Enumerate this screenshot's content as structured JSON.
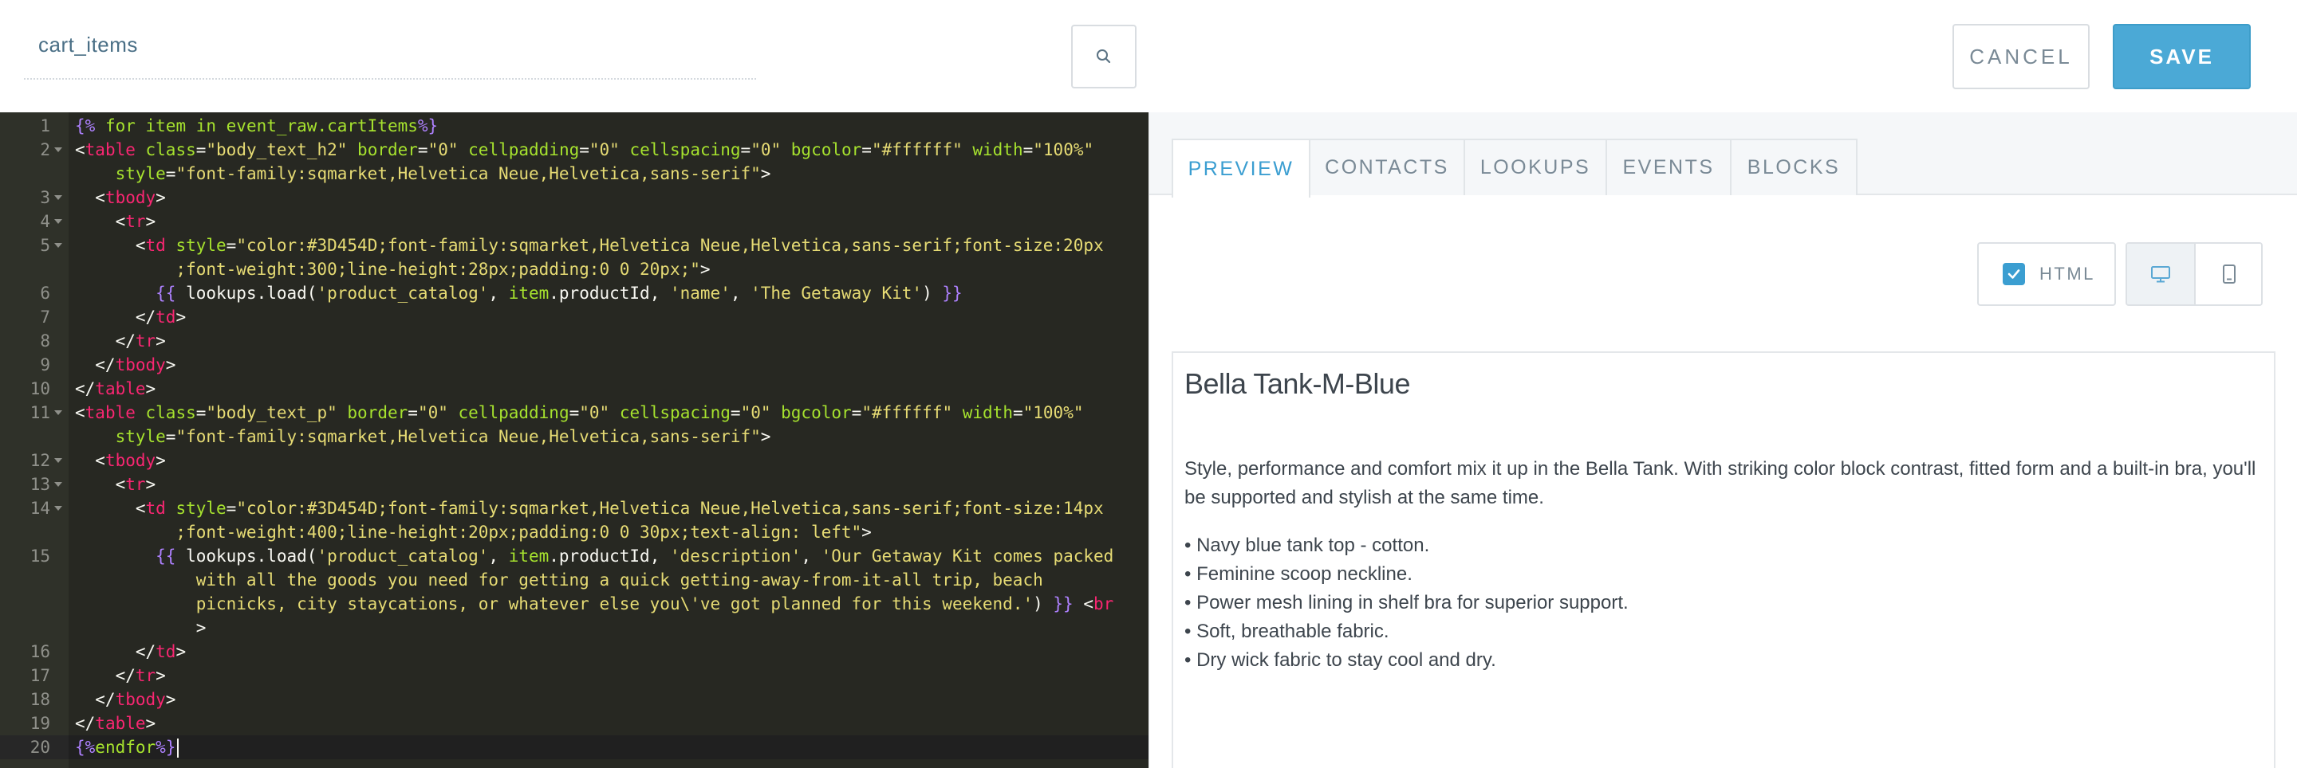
{
  "header": {
    "name_value": "cart_items",
    "cancel_label": "CANCEL",
    "save_label": "SAVE"
  },
  "editor": {
    "lines": [
      {
        "n": "1",
        "fold": false,
        "rows": [
          [
            [
              "dl",
              "{%"
            ],
            [
              "tp",
              " for item in event_raw.cartItems"
            ],
            [
              "dl",
              "%}"
            ]
          ]
        ]
      },
      {
        "n": "2",
        "fold": true,
        "rows": [
          [
            [
              "pt",
              "<"
            ],
            [
              "tg",
              "table"
            ],
            [
              "at",
              " class"
            ],
            [
              "pt",
              "="
            ],
            [
              "st",
              "\"body_text_h2\""
            ],
            [
              "at",
              " border"
            ],
            [
              "pt",
              "="
            ],
            [
              "st",
              "\"0\""
            ],
            [
              "at",
              " cellpadding"
            ],
            [
              "pt",
              "="
            ],
            [
              "st",
              "\"0\""
            ],
            [
              "at",
              " cellspacing"
            ],
            [
              "pt",
              "="
            ],
            [
              "st",
              "\"0\""
            ],
            [
              "at",
              " bgcolor"
            ],
            [
              "pt",
              "="
            ],
            [
              "st",
              "\"#ffffff\""
            ],
            [
              "at",
              " width"
            ],
            [
              "pt",
              "="
            ],
            [
              "st",
              "\"100%\""
            ]
          ],
          [
            [
              "at",
              "    style"
            ],
            [
              "pt",
              "="
            ],
            [
              "st",
              "\"font-family:sqmarket,Helvetica Neue,Helvetica,sans-serif\""
            ],
            [
              "pt",
              ">"
            ]
          ]
        ]
      },
      {
        "n": "3",
        "fold": true,
        "rows": [
          [
            [
              "pt",
              "  <"
            ],
            [
              "tg",
              "tbody"
            ],
            [
              "pt",
              ">"
            ]
          ]
        ]
      },
      {
        "n": "4",
        "fold": true,
        "rows": [
          [
            [
              "pt",
              "    <"
            ],
            [
              "tg",
              "tr"
            ],
            [
              "pt",
              ">"
            ]
          ]
        ]
      },
      {
        "n": "5",
        "fold": true,
        "rows": [
          [
            [
              "pt",
              "      <"
            ],
            [
              "tg",
              "td"
            ],
            [
              "at",
              " style"
            ],
            [
              "pt",
              "="
            ],
            [
              "st",
              "\"color:#3D454D;font-family:sqmarket,Helvetica Neue,Helvetica,sans-serif;font-size:20px"
            ]
          ],
          [
            [
              "st",
              "          ;font-weight:300;line-height:28px;padding:0 0 20px;\""
            ],
            [
              "pt",
              ">"
            ]
          ]
        ]
      },
      {
        "n": "6",
        "fold": false,
        "rows": [
          [
            [
              "dl",
              "        {{"
            ],
            [
              "fn",
              " lookups.load("
            ],
            [
              "st",
              "'product_catalog'"
            ],
            [
              "fn",
              ", "
            ],
            [
              "at",
              "item"
            ],
            [
              "fn",
              ".productId, "
            ],
            [
              "st",
              "'name'"
            ],
            [
              "fn",
              ", "
            ],
            [
              "st",
              "'The Getaway Kit'"
            ],
            [
              "fn",
              ") "
            ],
            [
              "dl",
              "}}"
            ]
          ]
        ]
      },
      {
        "n": "7",
        "fold": false,
        "rows": [
          [
            [
              "pt",
              "      </"
            ],
            [
              "tg",
              "td"
            ],
            [
              "pt",
              ">"
            ]
          ]
        ]
      },
      {
        "n": "8",
        "fold": false,
        "rows": [
          [
            [
              "pt",
              "    </"
            ],
            [
              "tg",
              "tr"
            ],
            [
              "pt",
              ">"
            ]
          ]
        ]
      },
      {
        "n": "9",
        "fold": false,
        "rows": [
          [
            [
              "pt",
              "  </"
            ],
            [
              "tg",
              "tbody"
            ],
            [
              "pt",
              ">"
            ]
          ]
        ]
      },
      {
        "n": "10",
        "fold": false,
        "rows": [
          [
            [
              "pt",
              "</"
            ],
            [
              "tg",
              "table"
            ],
            [
              "pt",
              ">"
            ]
          ]
        ]
      },
      {
        "n": "11",
        "fold": true,
        "rows": [
          [
            [
              "pt",
              "<"
            ],
            [
              "tg",
              "table"
            ],
            [
              "at",
              " class"
            ],
            [
              "pt",
              "="
            ],
            [
              "st",
              "\"body_text_p\""
            ],
            [
              "at",
              " border"
            ],
            [
              "pt",
              "="
            ],
            [
              "st",
              "\"0\""
            ],
            [
              "at",
              " cellpadding"
            ],
            [
              "pt",
              "="
            ],
            [
              "st",
              "\"0\""
            ],
            [
              "at",
              " cellspacing"
            ],
            [
              "pt",
              "="
            ],
            [
              "st",
              "\"0\""
            ],
            [
              "at",
              " bgcolor"
            ],
            [
              "pt",
              "="
            ],
            [
              "st",
              "\"#ffffff\""
            ],
            [
              "at",
              " width"
            ],
            [
              "pt",
              "="
            ],
            [
              "st",
              "\"100%\""
            ]
          ],
          [
            [
              "at",
              "    style"
            ],
            [
              "pt",
              "="
            ],
            [
              "st",
              "\"font-family:sqmarket,Helvetica Neue,Helvetica,sans-serif\""
            ],
            [
              "pt",
              ">"
            ]
          ]
        ]
      },
      {
        "n": "12",
        "fold": true,
        "rows": [
          [
            [
              "pt",
              "  <"
            ],
            [
              "tg",
              "tbody"
            ],
            [
              "pt",
              ">"
            ]
          ]
        ]
      },
      {
        "n": "13",
        "fold": true,
        "rows": [
          [
            [
              "pt",
              "    <"
            ],
            [
              "tg",
              "tr"
            ],
            [
              "pt",
              ">"
            ]
          ]
        ]
      },
      {
        "n": "14",
        "fold": true,
        "rows": [
          [
            [
              "pt",
              "      <"
            ],
            [
              "tg",
              "td"
            ],
            [
              "at",
              " style"
            ],
            [
              "pt",
              "="
            ],
            [
              "st",
              "\"color:#3D454D;font-family:sqmarket,Helvetica Neue,Helvetica,sans-serif;font-size:14px"
            ]
          ],
          [
            [
              "st",
              "          ;font-weight:400;line-height:20px;padding:0 0 30px;text-align: left\""
            ],
            [
              "pt",
              ">"
            ]
          ]
        ]
      },
      {
        "n": "15",
        "fold": false,
        "rows": [
          [
            [
              "dl",
              "        {{"
            ],
            [
              "fn",
              " lookups.load("
            ],
            [
              "st",
              "'product_catalog'"
            ],
            [
              "fn",
              ", "
            ],
            [
              "at",
              "item"
            ],
            [
              "fn",
              ".productId, "
            ],
            [
              "st",
              "'description'"
            ],
            [
              "fn",
              ", "
            ],
            [
              "st",
              "'Our Getaway Kit comes packed"
            ]
          ],
          [
            [
              "st",
              "            with all the goods you need for getting a quick getting-away-from-it-all trip, beach"
            ]
          ],
          [
            [
              "st",
              "            picnicks, city staycations, or whatever else you\\'ve got planned for this weekend.'"
            ],
            [
              "fn",
              ") "
            ],
            [
              "dl",
              "}}"
            ],
            [
              "pt",
              " <"
            ],
            [
              "tg",
              "br"
            ]
          ],
          [
            [
              "pt",
              "            >"
            ]
          ]
        ]
      },
      {
        "n": "16",
        "fold": false,
        "rows": [
          [
            [
              "pt",
              "      </"
            ],
            [
              "tg",
              "td"
            ],
            [
              "pt",
              ">"
            ]
          ]
        ]
      },
      {
        "n": "17",
        "fold": false,
        "rows": [
          [
            [
              "pt",
              "    </"
            ],
            [
              "tg",
              "tr"
            ],
            [
              "pt",
              ">"
            ]
          ]
        ]
      },
      {
        "n": "18",
        "fold": false,
        "rows": [
          [
            [
              "pt",
              "  </"
            ],
            [
              "tg",
              "tbody"
            ],
            [
              "pt",
              ">"
            ]
          ]
        ]
      },
      {
        "n": "19",
        "fold": false,
        "rows": [
          [
            [
              "pt",
              "</"
            ],
            [
              "tg",
              "table"
            ],
            [
              "pt",
              ">"
            ]
          ]
        ]
      },
      {
        "n": "20",
        "fold": false,
        "active": true,
        "rows": [
          [
            [
              "dl",
              "{%"
            ],
            [
              "tp",
              "endfor"
            ],
            [
              "dl",
              "%}"
            ]
          ]
        ]
      }
    ]
  },
  "tabs": [
    {
      "label": "PREVIEW",
      "active": true
    },
    {
      "label": "CONTACTS",
      "active": false
    },
    {
      "label": "LOOKUPS",
      "active": false
    },
    {
      "label": "EVENTS",
      "active": false
    },
    {
      "label": "BLOCKS",
      "active": false
    }
  ],
  "toolbar": {
    "html_label": "HTML",
    "html_checked": true
  },
  "preview": {
    "title": "Bella Tank-M-Blue",
    "description": "Style, performance and comfort mix it up in the Bella Tank. With striking color block contrast, fitted form and a built-in bra, you'll be supported and stylish at the same time.",
    "bullets": [
      "• Navy blue tank top - cotton.",
      "• Feminine scoop neckline.",
      "• Power mesh lining in shelf bra for superior support.",
      "• Soft, breathable fabric.",
      "• Dry wick fabric to stay cool and dry."
    ]
  },
  "icons": {
    "search": "search-icon",
    "check": "check-icon",
    "desktop": "desktop-icon",
    "mobile": "mobile-icon"
  },
  "colors": {
    "accent": "#4ba9d6",
    "editor_bg": "#272822",
    "text": "#3d454d"
  }
}
